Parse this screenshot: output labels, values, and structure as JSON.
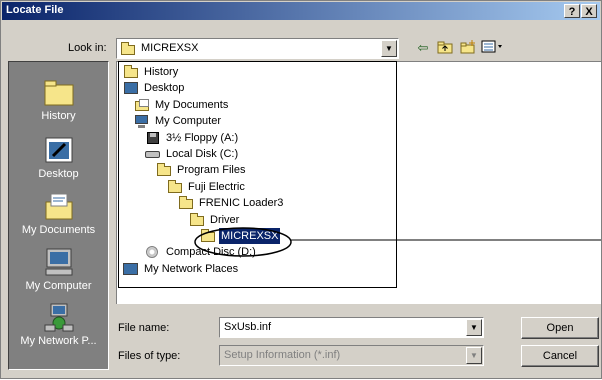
{
  "window": {
    "title": "Locate File",
    "help_label": "?",
    "close_label": "X"
  },
  "look_in": {
    "label": "Look in:",
    "value": "MICREXSX"
  },
  "toolbar": {
    "back_icon": "back-arrow-icon",
    "up_icon": "up-folder-icon",
    "new_folder_icon": "new-folder-icon",
    "views_icon": "views-menu-icon"
  },
  "places": [
    {
      "label": "History",
      "icon": "history-folder-icon"
    },
    {
      "label": "Desktop",
      "icon": "desktop-icon"
    },
    {
      "label": "My Documents",
      "icon": "my-documents-icon"
    },
    {
      "label": "My Computer",
      "icon": "my-computer-icon"
    },
    {
      "label": "My Network P...",
      "icon": "network-places-icon"
    }
  ],
  "dropdown_items": [
    {
      "label": "History",
      "icon": "folder",
      "indent": 0
    },
    {
      "label": "Desktop",
      "icon": "desktop",
      "indent": 0
    },
    {
      "label": "My Documents",
      "icon": "docs",
      "indent": 1
    },
    {
      "label": "My Computer",
      "icon": "pc",
      "indent": 1
    },
    {
      "label": "3½ Floppy (A:)",
      "icon": "floppy",
      "indent": 2
    },
    {
      "label": "Local Disk (C:)",
      "icon": "disk",
      "indent": 2
    },
    {
      "label": "Program Files",
      "icon": "folder",
      "indent": 3
    },
    {
      "label": "Fuji Electric",
      "icon": "folder",
      "indent": 4
    },
    {
      "label": "FRENIC Loader3",
      "icon": "folder",
      "indent": 5
    },
    {
      "label": "Driver",
      "icon": "folder",
      "indent": 6
    },
    {
      "label": "MICREXSX",
      "icon": "folder",
      "indent": 7,
      "selected": true
    },
    {
      "label": "Compact Disc (D:)",
      "icon": "cd",
      "indent": 2
    },
    {
      "label": "My Network Places",
      "icon": "net",
      "indent": 0
    }
  ],
  "file_name": {
    "label": "File name:",
    "value": "SxUsb.inf"
  },
  "file_type": {
    "label": "Files of type:",
    "value": "Setup Information (*.inf)"
  },
  "buttons": {
    "open": "Open",
    "cancel": "Cancel"
  }
}
